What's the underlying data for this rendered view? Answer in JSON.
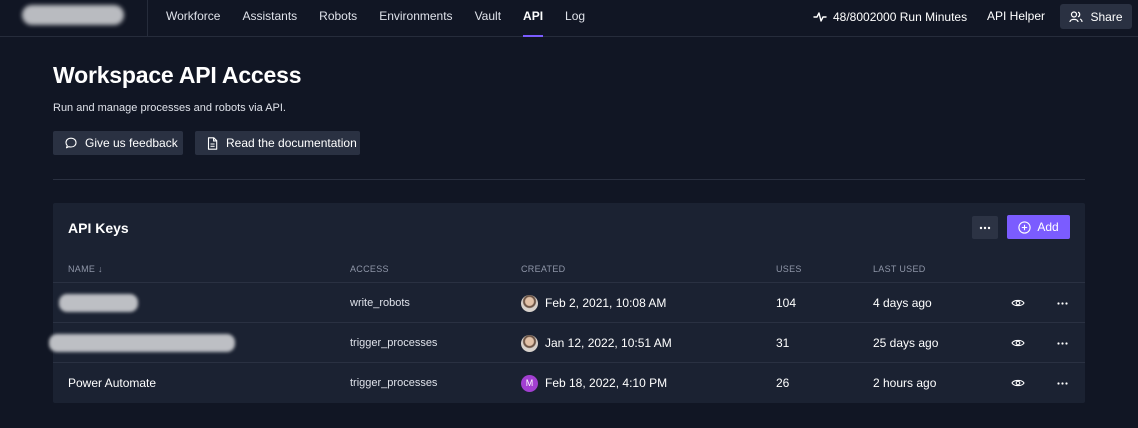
{
  "nav": {
    "items": [
      {
        "label": "Workforce",
        "active": false
      },
      {
        "label": "Assistants",
        "active": false
      },
      {
        "label": "Robots",
        "active": false
      },
      {
        "label": "Environments",
        "active": false
      },
      {
        "label": "Vault",
        "active": false
      },
      {
        "label": "API",
        "active": true
      },
      {
        "label": "Log",
        "active": false
      }
    ],
    "run_minutes": "48/8002000 Run Minutes",
    "api_helper": "API Helper",
    "share": "Share"
  },
  "header": {
    "title": "Workspace API Access",
    "subtitle": "Run and manage processes and robots via API.",
    "feedback_button": "Give us feedback",
    "docs_button": "Read the documentation"
  },
  "panel": {
    "title": "API Keys",
    "add_button": "Add",
    "columns": {
      "name": "NAME ↓",
      "access": "ACCESS",
      "created": "CREATED",
      "uses": "USES",
      "last_used": "LAST USED"
    },
    "rows": [
      {
        "name": "",
        "name_redacted": true,
        "access": "write_robots",
        "creator_avatar": "photo",
        "creator_initial": "",
        "created": "Feb 2, 2021, 10:08 AM",
        "uses": "104",
        "last_used": "4 days ago"
      },
      {
        "name": "",
        "name_redacted": true,
        "access": "trigger_processes",
        "creator_avatar": "photo",
        "creator_initial": "",
        "created": "Jan 12, 2022, 10:51 AM",
        "uses": "31",
        "last_used": "25 days ago"
      },
      {
        "name": "Power Automate",
        "name_redacted": false,
        "access": "trigger_processes",
        "creator_avatar": "initial",
        "creator_initial": "M",
        "created": "Feb 18, 2022, 4:10 PM",
        "uses": "26",
        "last_used": "2 hours ago"
      }
    ]
  },
  "colors": {
    "background": "#111624",
    "panel": "#1b2232",
    "accent": "#7b5cff",
    "button": "#2a3142"
  }
}
